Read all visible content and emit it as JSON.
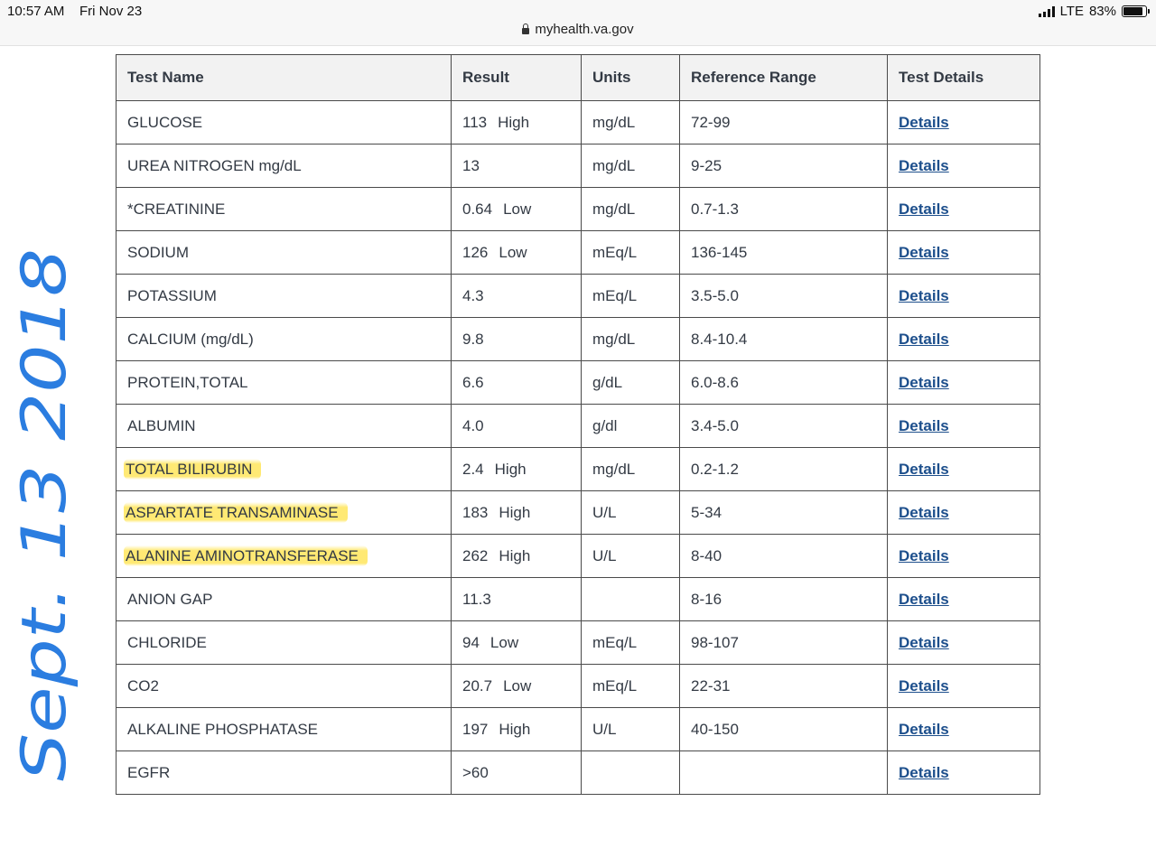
{
  "status_bar": {
    "time": "10:57 AM",
    "date": "Fri Nov 23",
    "network": "LTE",
    "battery": "83%"
  },
  "url": "myhealth.va.gov",
  "table": {
    "headers": [
      "Test Name",
      "Result",
      "Units",
      "Reference Range",
      "Test Details"
    ],
    "rows": [
      {
        "name": "GLUCOSE",
        "value": "113",
        "flag": "High",
        "units": "mg/dL",
        "range": "72-99",
        "details": "Details",
        "highlighted": false
      },
      {
        "name": "UREA NITROGEN mg/dL",
        "value": "13",
        "flag": "",
        "units": "mg/dL",
        "range": "9-25",
        "details": "Details",
        "highlighted": false
      },
      {
        "name": "*CREATININE",
        "value": "0.64",
        "flag": "Low",
        "units": "mg/dL",
        "range": "0.7-1.3",
        "details": "Details",
        "highlighted": false
      },
      {
        "name": "SODIUM",
        "value": "126",
        "flag": "Low",
        "units": "mEq/L",
        "range": "136-145",
        "details": "Details",
        "highlighted": false
      },
      {
        "name": "POTASSIUM",
        "value": "4.3",
        "flag": "",
        "units": "mEq/L",
        "range": "3.5-5.0",
        "details": "Details",
        "highlighted": false
      },
      {
        "name": "CALCIUM (mg/dL)",
        "value": "9.8",
        "flag": "",
        "units": "mg/dL",
        "range": "8.4-10.4",
        "details": "Details",
        "highlighted": false
      },
      {
        "name": "PROTEIN,TOTAL",
        "value": "6.6",
        "flag": "",
        "units": "g/dL",
        "range": "6.0-8.6",
        "details": "Details",
        "highlighted": false
      },
      {
        "name": "ALBUMIN",
        "value": "4.0",
        "flag": "",
        "units": "g/dl",
        "range": "3.4-5.0",
        "details": "Details",
        "highlighted": false
      },
      {
        "name": "TOTAL BILIRUBIN",
        "value": "2.4",
        "flag": "High",
        "units": "mg/dL",
        "range": "0.2-1.2",
        "details": "Details",
        "highlighted": true
      },
      {
        "name": "ASPARTATE TRANSAMINASE",
        "value": "183",
        "flag": "High",
        "units": "U/L",
        "range": "5-34",
        "details": "Details",
        "highlighted": true
      },
      {
        "name": "ALANINE AMINOTRANSFERASE",
        "value": "262",
        "flag": "High",
        "units": "U/L",
        "range": "8-40",
        "details": "Details",
        "highlighted": true
      },
      {
        "name": "ANION GAP",
        "value": "11.3",
        "flag": "",
        "units": "",
        "range": "8-16",
        "details": "Details",
        "highlighted": false
      },
      {
        "name": "CHLORIDE",
        "value": "94",
        "flag": "Low",
        "units": "mEq/L",
        "range": "98-107",
        "details": "Details",
        "highlighted": false
      },
      {
        "name": "CO2",
        "value": "20.7",
        "flag": "Low",
        "units": "mEq/L",
        "range": "22-31",
        "details": "Details",
        "highlighted": false
      },
      {
        "name": "ALKALINE PHOSPHATASE",
        "value": "197",
        "flag": "High",
        "units": "U/L",
        "range": "40-150",
        "details": "Details",
        "highlighted": false
      },
      {
        "name": "EGFR",
        "value": ">60",
        "flag": "",
        "units": "",
        "range": "",
        "details": "Details",
        "highlighted": false
      }
    ]
  },
  "annotation": {
    "text": "Sept. 13 2018",
    "color": "#2b7de0"
  },
  "colors": {
    "link": "#1d4f8c",
    "highlight": "#ffe246",
    "header_bg": "#f2f2f2"
  }
}
